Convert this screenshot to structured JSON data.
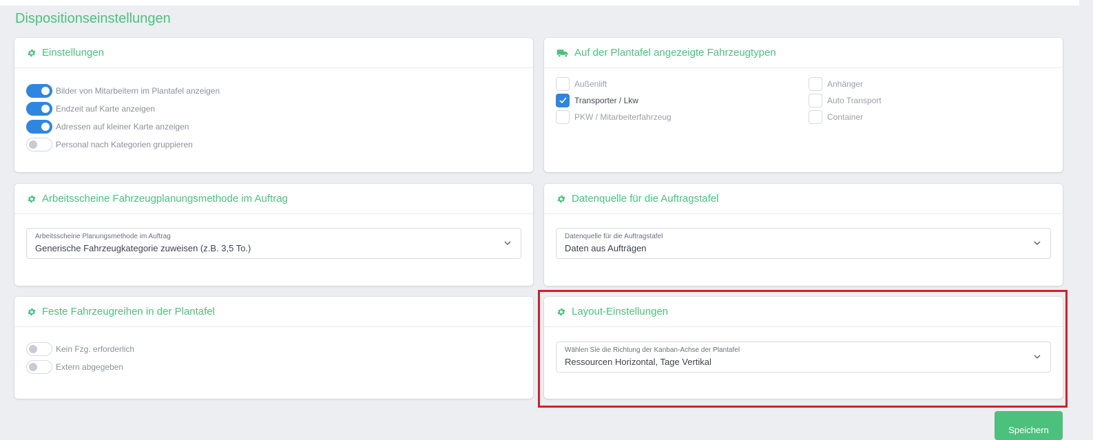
{
  "page": {
    "title": "Dispositionseinstellungen"
  },
  "settings": {
    "title": "Einstellungen",
    "toggles": [
      {
        "label": "Bilder von Mitarbeitern im Plantafel anzeigen",
        "on": true
      },
      {
        "label": "Endzeit auf Karte anzeigen",
        "on": true
      },
      {
        "label": "Adressen auf kleiner Karte anzeigen",
        "on": true
      },
      {
        "label": "Personal nach Kategorien gruppieren",
        "on": false
      }
    ]
  },
  "vehicle_types": {
    "title": "Auf der Plantafel angezeigte Fahrzeugtypen",
    "items": [
      {
        "label": "Außenlift",
        "checked": false
      },
      {
        "label": "Anhänger",
        "checked": false
      },
      {
        "label": "Transporter / Lkw",
        "checked": true
      },
      {
        "label": "Auto Transport",
        "checked": false
      },
      {
        "label": "PKW / Mitarbeiterfahrzeug",
        "checked": false
      },
      {
        "label": "Container",
        "checked": false
      }
    ]
  },
  "planning_method": {
    "title": "Arbeitsscheine Fahrzeugplanungsmethode im Auftrag",
    "select_label": "Arbeitsscheine Planungsmethode im Auftrag",
    "select_value": "Generische Fahrzeugkategorie zuweisen (z.B. 3,5 To.)"
  },
  "data_source": {
    "title": "Datenquelle für die Auftragstafel",
    "select_label": "Datenquelle für die Auftragstafel",
    "select_value": "Daten aus Aufträgen"
  },
  "fixed_rows": {
    "title": "Feste Fahrzeugreihen in der Plantafel",
    "toggles": [
      {
        "label": "Kein Fzg. erforderlich",
        "on": false
      },
      {
        "label": "Extern abgegeben",
        "on": false
      }
    ]
  },
  "layout": {
    "title": "Layout-Einstellungen",
    "select_label": "Wählen Sie die Richtung der Kanban-Achse der Plantafel",
    "select_value": "Ressourcen Horizontal, Tage Vertikal"
  },
  "actions": {
    "save_label": "Speichern"
  },
  "colors": {
    "accent": "#4cc17e",
    "toggle_on": "#2f86e0",
    "highlight": "#d0202a",
    "background": "#eceef2"
  }
}
